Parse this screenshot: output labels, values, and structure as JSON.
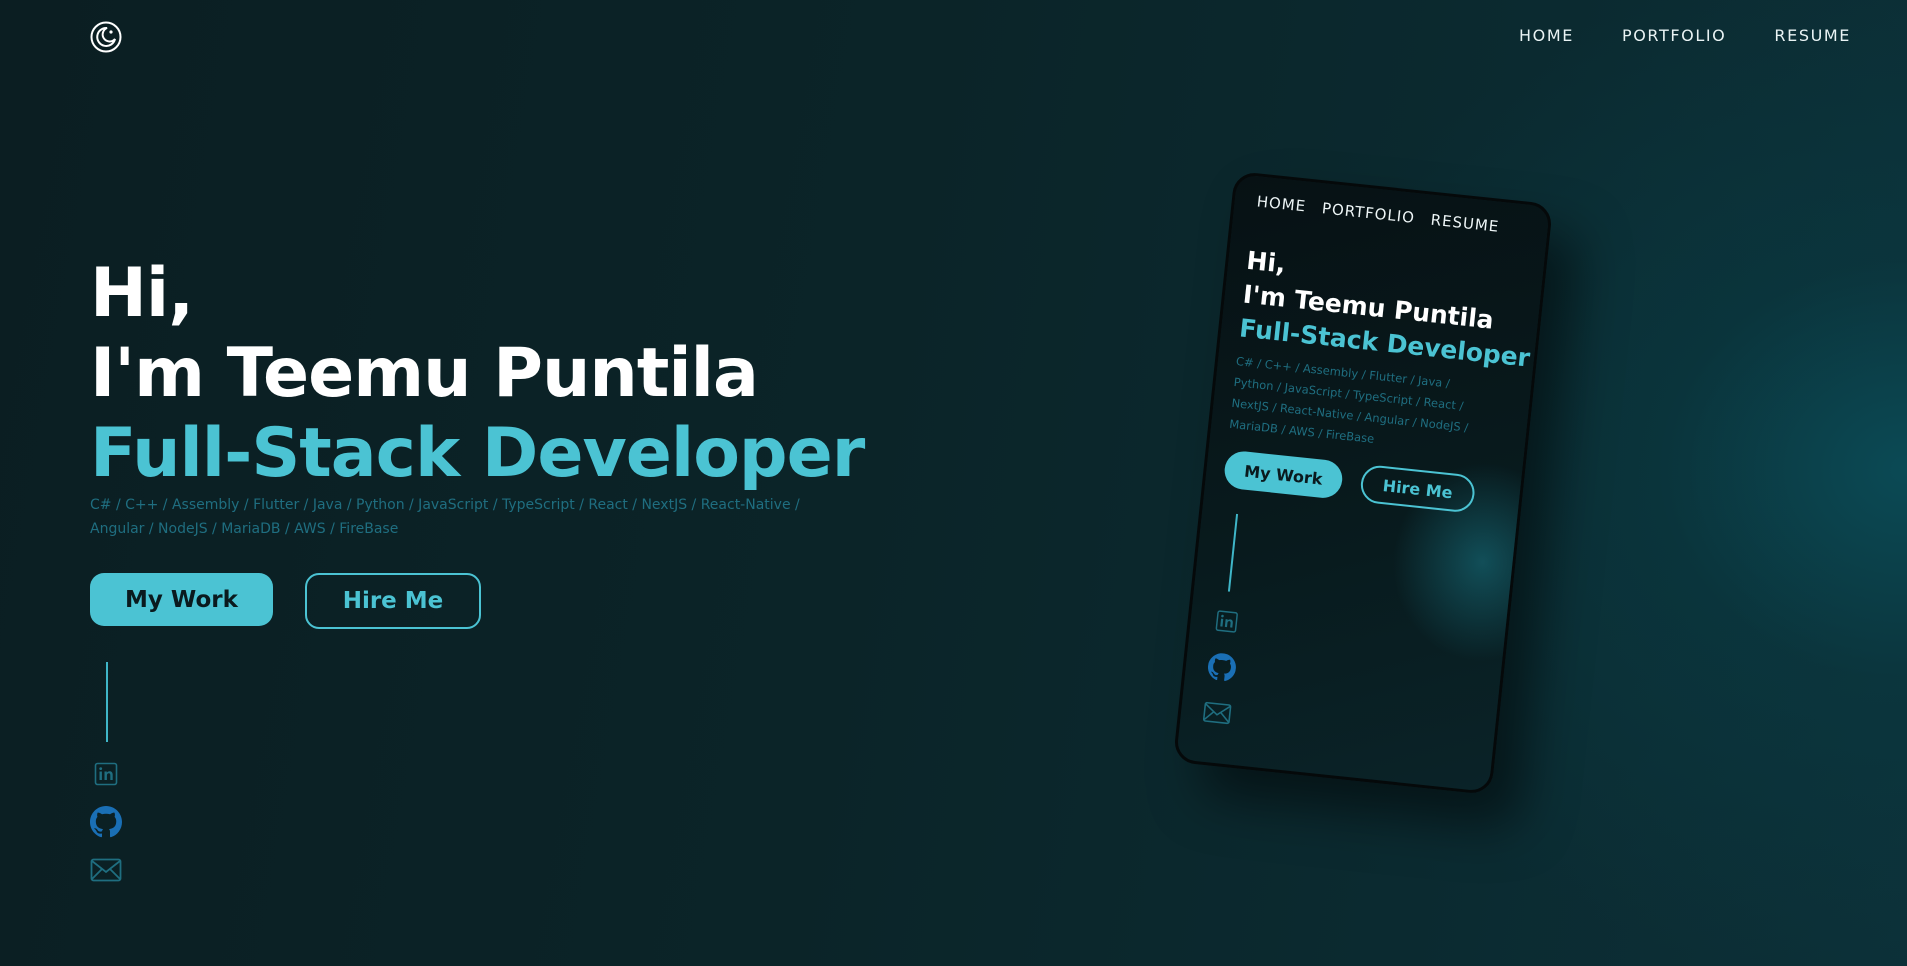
{
  "header": {
    "logo_icon": "moon-sun-theme-icon",
    "nav": [
      {
        "label": "HOME"
      },
      {
        "label": "PORTFOLIO"
      },
      {
        "label": "RESUME"
      }
    ]
  },
  "hero": {
    "greeting": "Hi,",
    "name_line": "I'm Teemu Puntila",
    "role": "Full-Stack Developer",
    "skills": [
      "C#",
      "C++",
      "Assembly",
      "Flutter",
      "Java",
      "Python",
      "JavaScript",
      "TypeScript",
      "React",
      "NextJS",
      "React-Native",
      "Angular",
      "NodeJS",
      "MariaDB",
      "AWS",
      "FireBase"
    ],
    "skills_line1": "C# / C++ / Assembly / Flutter / Java / Python / JavaScript / TypeScript / React / NextJS / React-Native /",
    "skills_line2": "Angular / NodeJS / MariaDB / AWS / FireBase",
    "buttons": {
      "work": "My Work",
      "hire": "Hire Me"
    }
  },
  "social": [
    {
      "icon": "linkedin-icon"
    },
    {
      "icon": "github-icon"
    },
    {
      "icon": "mail-icon"
    }
  ],
  "phone_mockup": {
    "nav": [
      "HOME",
      "PORTFOLIO",
      "RESUME"
    ],
    "greeting": "Hi,",
    "name_line": "I'm Teemu Puntila",
    "role": "Full-Stack Developer",
    "skills_lines": [
      "C# / C++ / Assembly / Flutter / Java /",
      "Python / JavaScript / TypeScript / React /",
      "NextJS / React-Native / Angular / NodeJS /",
      "MariaDB / AWS / FireBase"
    ],
    "work": "My Work",
    "hire": "Hire Me"
  },
  "colors": {
    "accent": "#4bc3d3",
    "background": "#0b2428",
    "muted_skills": "#1f6e80",
    "social_icon": "#1f6e80",
    "github": "#1a6fb5"
  }
}
